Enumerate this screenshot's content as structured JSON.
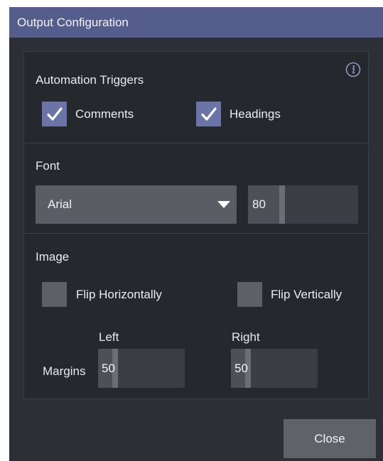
{
  "window": {
    "title": "Output Configuration"
  },
  "automation": {
    "title": "Automation Triggers",
    "info_icon": "info-icon",
    "comments": {
      "label": "Comments",
      "checked": true
    },
    "headings": {
      "label": "Headings",
      "checked": true
    }
  },
  "font": {
    "title": "Font",
    "family": "Arial",
    "size": {
      "value": "80",
      "fraction": 0.31
    }
  },
  "image": {
    "title": "Image",
    "flip_horizontal": {
      "label": "Flip Horizontally",
      "checked": false
    },
    "flip_vertical": {
      "label": "Flip Vertically",
      "checked": false
    },
    "margins_label": "Margins",
    "left": {
      "label": "Left",
      "value": "50",
      "fraction": 0.2
    },
    "right": {
      "label": "Right",
      "value": "50",
      "fraction": 0.2
    }
  },
  "footer": {
    "close_label": "Close"
  },
  "colors": {
    "titlebar": "#555d8c",
    "checkbox_checked": "#6b74a6",
    "dialog_bg": "#2c2f35",
    "panel_bg": "#25282c"
  }
}
